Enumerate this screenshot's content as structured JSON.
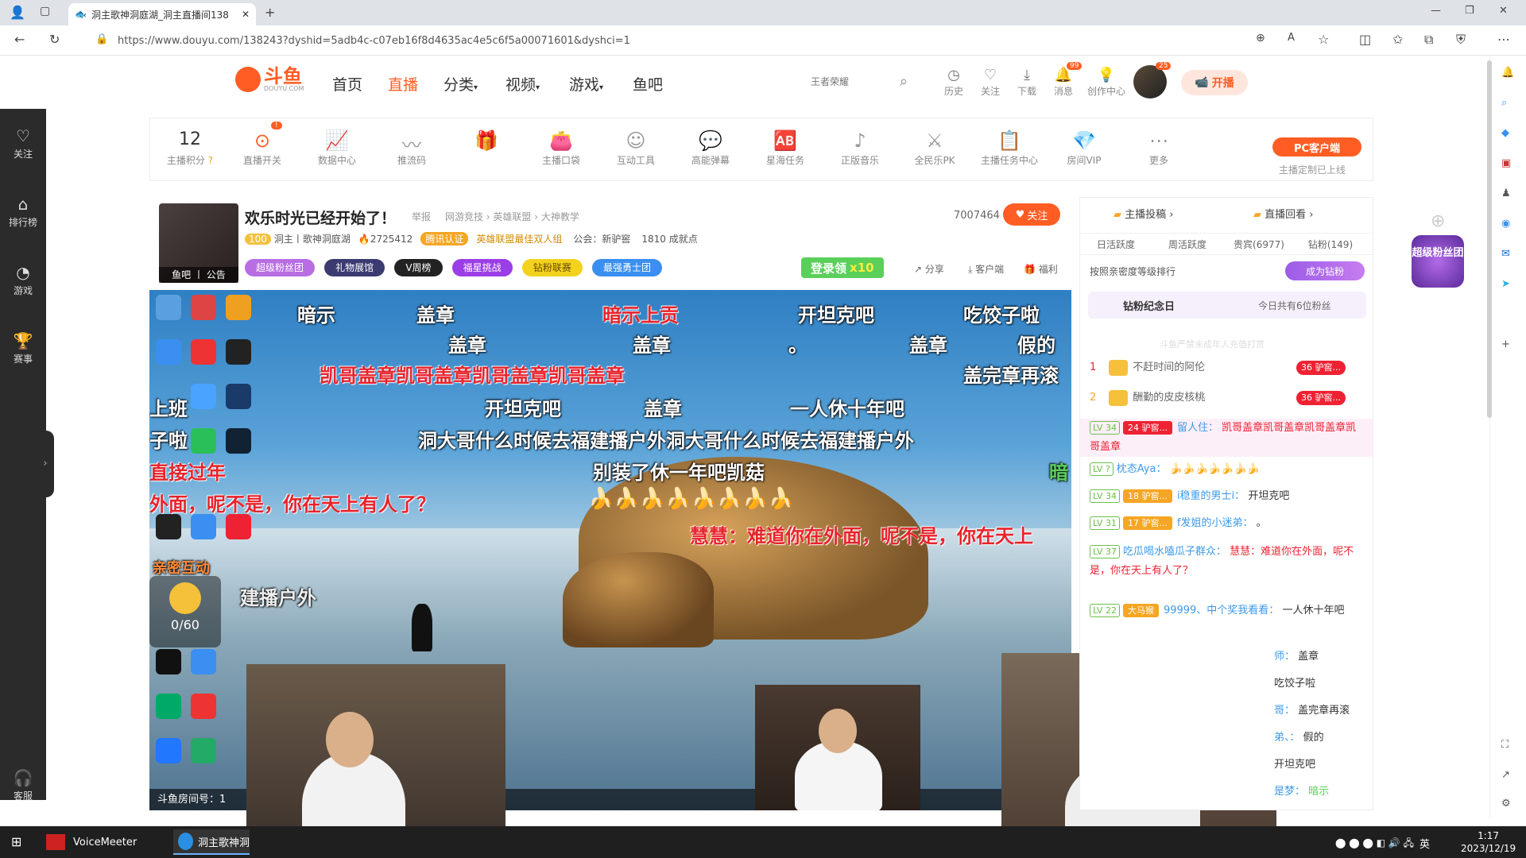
{
  "browser": {
    "tab_title": "洞主歌神洞庭湖_洞主直播间138",
    "url": "https://www.douyu.com/138243?dyshid=5adb4c-c07eb16f8d4635ac4e5c6f5a00071601&dyshci=1"
  },
  "header": {
    "logo": "斗鱼",
    "logo_sub": "DOUYU.COM",
    "nav": [
      "首页",
      "直播",
      "分类",
      "视频",
      "游戏",
      "鱼吧"
    ],
    "search_placeholder": "王者荣耀",
    "icons": [
      "历史",
      "关注",
      "下载",
      "消息",
      "创作中心"
    ],
    "msg_badge": "99",
    "avatar_badge": "25",
    "start_live": "开播"
  },
  "left_sidebar": [
    "关注",
    "排行榜",
    "游戏",
    "赛事",
    "客服"
  ],
  "toolbar": {
    "score_value": "12",
    "score_label": "主播积分",
    "switch_badge": "!",
    "tools": [
      "直播开关",
      "数据中心",
      "推流码",
      "",
      "主播口袋",
      "互动工具",
      "高能弹幕",
      "星海任务",
      "正版音乐",
      "全民乐PK",
      "主播任务中心",
      "房间VIP",
      "更多"
    ],
    "pc_client": "PC客户端",
    "pc_client_sub": "主播定制已上线"
  },
  "room": {
    "title": "欢乐时光已经开始了！",
    "report": "举报",
    "category": "网游竞技 › 英雄联盟 › 大神教学",
    "level_badge": "100",
    "streamer": "洞主丨歌神洞庭湖",
    "heat": "2725412",
    "verified": "腾讯认证",
    "honor": "英雄联盟最佳双人组",
    "guild": "公会：新驴窖",
    "achievements": "1810 成就点",
    "viewers": "7007464",
    "follow": "关注",
    "avatar_caption": "鱼吧 丨 公告",
    "tags": [
      "超级粉丝团",
      "礼物展馆",
      "V周榜",
      "福星挑战",
      "钻粉联赛",
      "最强勇士团"
    ],
    "login_reward": "登录领",
    "login_reward_count": "x10",
    "share": "分享",
    "client": "客户端",
    "welfare": "福利"
  },
  "danmaku": [
    "暗示",
    "盖章",
    "暗示上贡",
    "开坦克吧",
    "吃饺子啦",
    "盖章",
    "盖章",
    "。",
    "盖章",
    "假的",
    "凯哥盖章凯哥盖章凯哥盖章凯哥盖章",
    "盖完章再滚",
    "上班",
    "开坦克吧",
    "盖章",
    "一人休十年吧",
    "子啦",
    "洞大哥什么时候去福建播户外洞大哥什么时候去福建播户外",
    "直接过年",
    "别装了休一年吧凯菇",
    "暗",
    "外面，呢不是，你在天上有人了？",
    "慧慧：难道你在外面，呢不是，你在天上",
    "亲密互动",
    "建播户外"
  ],
  "interaction_counter": "0/60",
  "video_footer": "斗鱼房间号：1",
  "right_panel": {
    "top_links": [
      "主播投稿",
      "直播回看"
    ],
    "tabs": [
      "日活跃度",
      "周活跃度",
      "贵宾(6977)",
      "钻粉(149)"
    ],
    "rank_hint": "按照亲密度等级排行",
    "become_diamond": "成为钻粉",
    "diamond_day": "钻粉纪念日",
    "diamond_today": "今日共有6位粉丝",
    "notice": "斗鱼严禁未成年人充值打赏",
    "rank": [
      {
        "no": "1",
        "name": "不赶时间的阿伦",
        "lv": "36",
        "tag": "驴窖..."
      },
      {
        "no": "2",
        "name": "酬勤的皮皮核桃",
        "lv": "36",
        "tag": "驴窖..."
      }
    ],
    "chat": [
      {
        "lv": "LV 34",
        "fan": "24 驴窖...",
        "user": "留人住：",
        "text": "凯哥盖章凯哥盖章凯哥盖章凯哥盖章"
      },
      {
        "lv": "LV ?",
        "fan": "",
        "user": "枕态Aya：",
        "text": "🍌🍌🍌🍌🍌🍌🍌"
      },
      {
        "lv": "LV 34",
        "fan": "18 驴窖...",
        "user": "i稳重的男士i：",
        "text": "开坦克吧"
      },
      {
        "lv": "LV 31",
        "fan": "17 驴窖...",
        "user": "f发姐的小迷弟：",
        "text": "。"
      },
      {
        "lv": "LV 37",
        "fan": "",
        "user": "吃瓜喝水嗑瓜子群众：",
        "text": "慧慧：难道你在外面，呢不是，你在天上有人了？"
      },
      {
        "lv": "LV 22",
        "fan": "大马猴",
        "user": "99999、中个奖我看看：",
        "text": "一人休十年吧"
      },
      {
        "lv": "",
        "fan": "",
        "user": "师：",
        "text": "盖章"
      },
      {
        "lv": "",
        "fan": "",
        "user": "",
        "text": "吃饺子啦"
      },
      {
        "lv": "",
        "fan": "",
        "user": "哥：",
        "text": "盖完章再滚"
      },
      {
        "lv": "",
        "fan": "",
        "user": "弟、：",
        "text": "假的"
      },
      {
        "lv": "",
        "fan": "",
        "user": "",
        "text": "开坦克吧"
      },
      {
        "lv": "",
        "fan": "",
        "user": "是梦：",
        "text": "暗示"
      }
    ]
  },
  "float_badge": "超级粉丝团",
  "taskbar": {
    "apps": [
      "VoiceMeeter",
      "洞主歌神洞"
    ],
    "ime": "英",
    "time": "1:17",
    "date": "2023/12/19"
  },
  "colors": {
    "brand": "#ff5d23",
    "nav_active": "#ff5d23",
    "chat_user": "#3d9ae8",
    "level_green": "#6cc04a"
  }
}
